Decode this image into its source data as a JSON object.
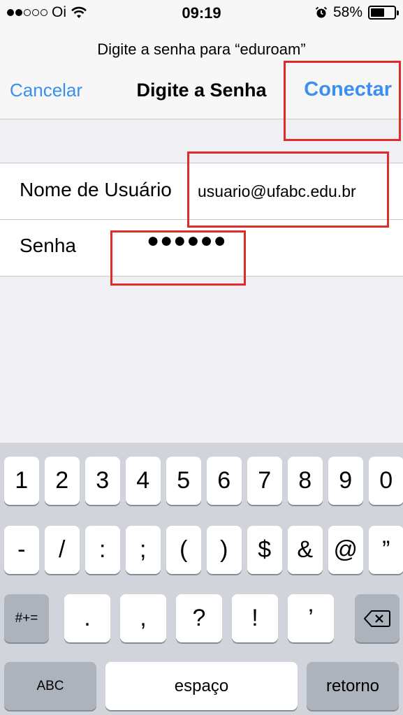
{
  "status": {
    "carrier": "Oi",
    "signal_filled": 2,
    "signal_total": 5,
    "wifi_icon": "wifi-icon",
    "time": "09:19",
    "alarm_icon": "alarm-icon",
    "battery": "58%",
    "battery_level": 0.58
  },
  "nav": {
    "prompt": "Digite a senha para “eduroam”",
    "cancel": "Cancelar",
    "title": "Digite a Senha",
    "connect": "Conectar",
    "accent_color": "#3b8ff2"
  },
  "form": {
    "username_label": "Nome de Usuário",
    "username_value": "usuario@ufabc.edu.br",
    "password_label": "Senha",
    "password_value": "●●●●●●"
  },
  "annotation_color": "#e02b2b",
  "keyboard": {
    "row1": [
      "1",
      "2",
      "3",
      "4",
      "5",
      "6",
      "7",
      "8",
      "9",
      "0"
    ],
    "row2": [
      "-",
      "/",
      ":",
      ";",
      "(",
      ")",
      "$",
      "&",
      "@",
      "”"
    ],
    "row3": [
      ".",
      ",",
      "?",
      "!",
      "’"
    ],
    "symbols": "#+=",
    "delete_icon": "backspace-icon",
    "abc": "ABC",
    "space": "espaço",
    "return": "retorno"
  }
}
